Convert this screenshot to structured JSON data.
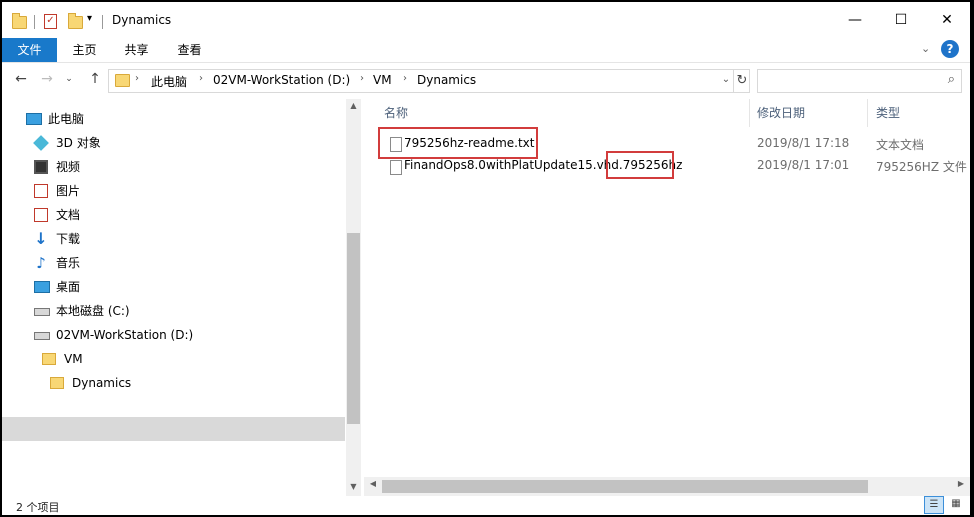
{
  "window": {
    "title": "Dynamics",
    "quick_access": [
      "folder-icon",
      "properties-check-icon",
      "new-folder-icon",
      "customize-dropdown-icon"
    ],
    "controls": {
      "minimize": "—",
      "maximize": "☐",
      "close": "✕"
    }
  },
  "ribbon": {
    "tabs": [
      {
        "label": "文件",
        "active": true
      },
      {
        "label": "主页",
        "active": false
      },
      {
        "label": "共享",
        "active": false
      },
      {
        "label": "查看",
        "active": false
      }
    ]
  },
  "address": {
    "crumbs": [
      "此电脑",
      "02VM-WorkStation (D:)",
      "VM",
      "Dynamics"
    ],
    "search_placeholder": ""
  },
  "nav": {
    "items": [
      {
        "label": "此电脑",
        "icon": "computer-icon"
      },
      {
        "label": "3D 对象",
        "icon": "3d-objects-icon"
      },
      {
        "label": "视频",
        "icon": "video-icon"
      },
      {
        "label": "图片",
        "icon": "pictures-icon"
      },
      {
        "label": "文档",
        "icon": "documents-icon"
      },
      {
        "label": "下载",
        "icon": "download-icon"
      },
      {
        "label": "音乐",
        "icon": "music-icon"
      },
      {
        "label": "桌面",
        "icon": "desktop-icon"
      },
      {
        "label": "本地磁盘 (C:)",
        "icon": "drive-c-icon"
      },
      {
        "label": "02VM-WorkStation (D:)",
        "icon": "drive-d-icon"
      },
      {
        "label": "VM",
        "icon": "folder-icon"
      },
      {
        "label": "Dynamics",
        "icon": "folder-icon"
      }
    ]
  },
  "columns": {
    "name": "名称",
    "modified": "修改日期",
    "type": "类型"
  },
  "files": [
    {
      "name": "795256hz-readme.txt",
      "modified": "2019/8/1 17:18",
      "type": "文本文档",
      "highlighted": true
    },
    {
      "name_base": "FinandOps8.0withPlatUpdate15.vhd",
      "name_ext": ".795256hz",
      "modified": "2019/8/1 17:01",
      "type": "795256HZ 文件",
      "highlighted_ext": true
    }
  ],
  "status": {
    "count": "2 个项目"
  },
  "colors": {
    "accent": "#1979ca",
    "highlight_box": "#d23c3c",
    "header_text": "#4c607a"
  }
}
